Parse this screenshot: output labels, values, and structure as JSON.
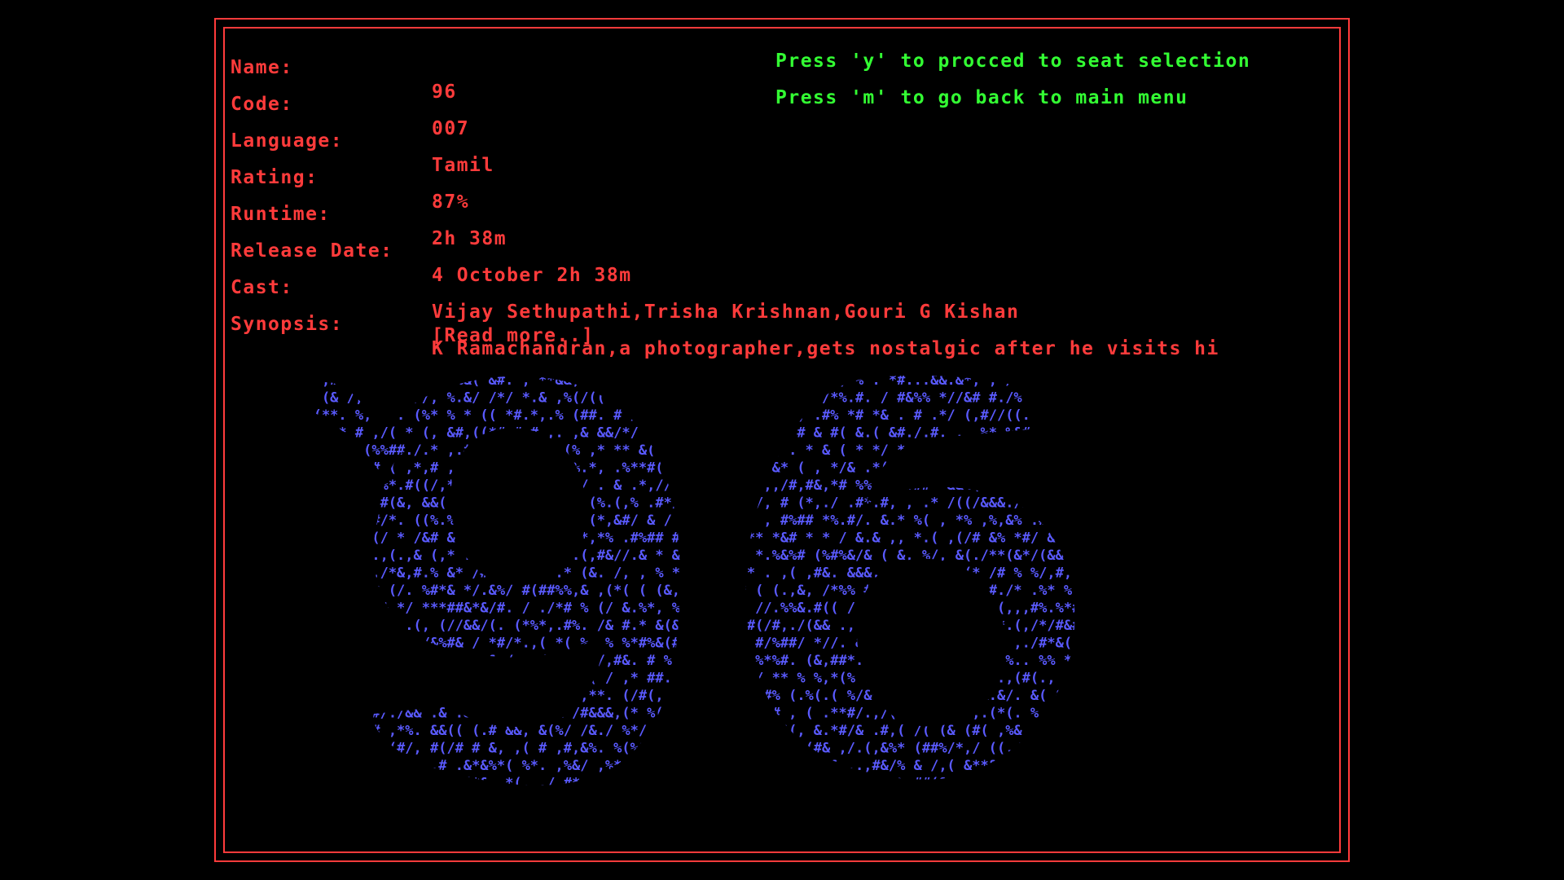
{
  "movie": {
    "fields": [
      {
        "label": "Name:",
        "value": "96"
      },
      {
        "label": "Code:",
        "value": "007"
      },
      {
        "label": "Language:",
        "value": "Tamil"
      },
      {
        "label": "Rating:",
        "value": "87%"
      },
      {
        "label": "Runtime:",
        "value": "2h 38m"
      },
      {
        "label": "Release Date:",
        "value": "4 October 2h 38m"
      },
      {
        "label": "Cast:",
        "value": "Vijay Sethupathi,Trisha Krishnan,Gouri G Kishan"
      },
      {
        "label": "Synopsis:",
        "value": "K Ramachandran,a photographer,gets nostalgic after he visits hi"
      }
    ],
    "read_more": "[Read more..]"
  },
  "prompts": {
    "seat_selection": "Press 'y' to procced to seat selection",
    "main_menu": "Press 'm' to go back to main menu"
  },
  "poster": {
    "ascii_title": "96",
    "color": "#5a5aff"
  },
  "colors": {
    "info_text": "#ff3b3b",
    "prompt_text": "#33ff33",
    "border": "#ff3b3b",
    "background": "#000000"
  }
}
